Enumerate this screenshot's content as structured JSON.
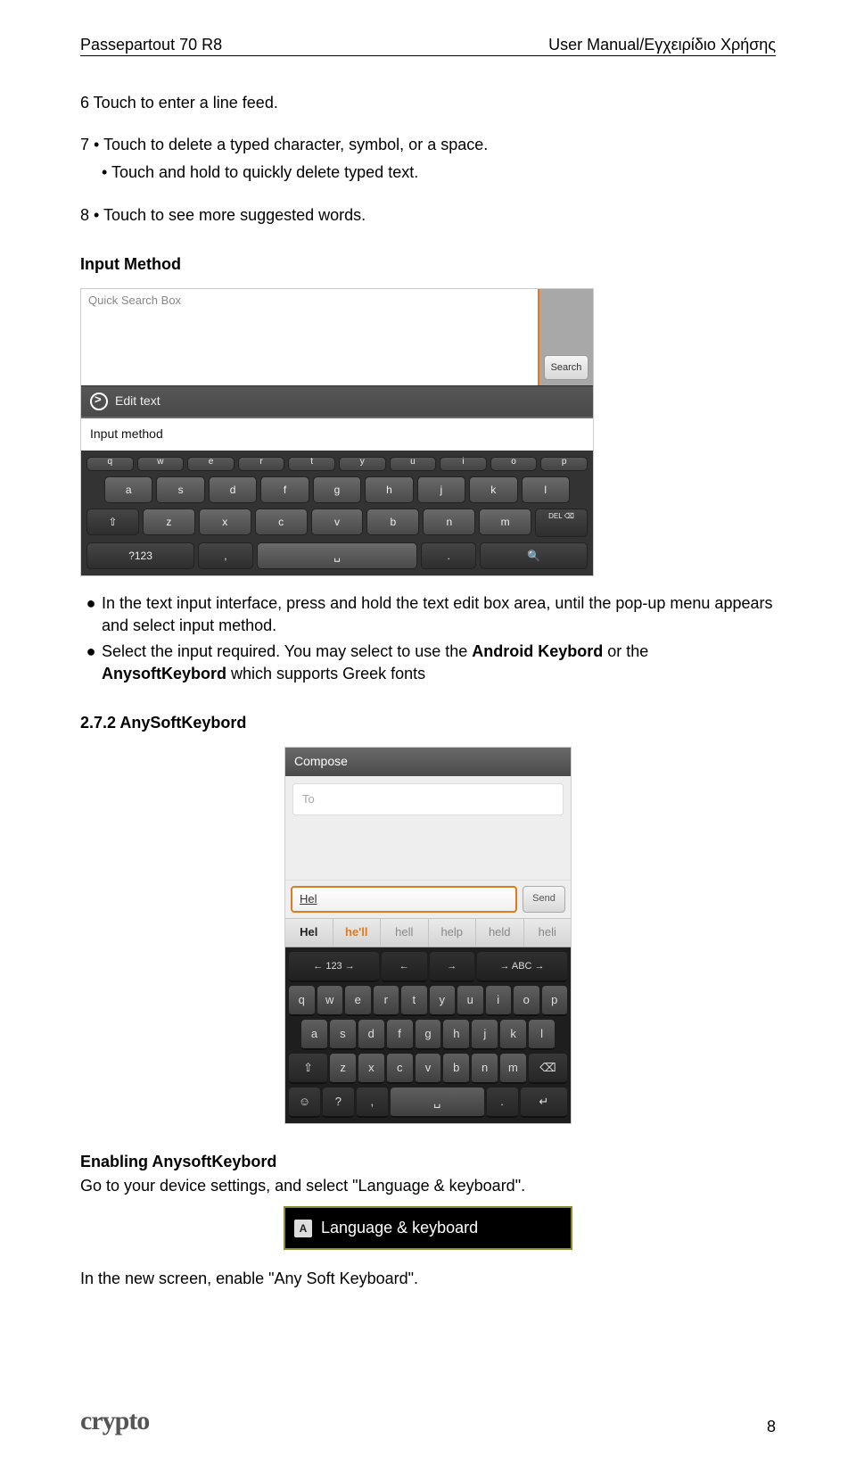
{
  "doc_header": {
    "left": "Passepartout 70 R8",
    "right": "User Manual/Εγχειρίδιο Χρήσης"
  },
  "body": {
    "p1": "6  Touch to enter a line feed.",
    "p2": "7 • Touch to delete a typed character, symbol, or a space.",
    "p2b": "• Touch and hold to quickly delete typed text.",
    "p3": "8 • Touch to see more suggested words.",
    "h_input": "Input Method",
    "bul1": "In the text input interface, press and hold the text edit box area, until the pop-up menu appears and select input method.",
    "bul2a": "Select the input required. You may select to use the ",
    "bul2b": "Android Keybord",
    "bul2c": " or the ",
    "bul2d": "AnysoftKeybord",
    "bul2e": " which supports Greek fonts",
    "h_272": "2.7.2 AnySoftKeybord",
    "h_enable": "Enabling AnysoftKeybord",
    "p_enable": "Go to your device settings, and select \"Language & keyboard\".",
    "p_last": "In the new screen, enable \"Any Soft Keyboard\"."
  },
  "screenshot1": {
    "qsb": "Quick Search Box",
    "search": "Search",
    "edit_text": "Edit text",
    "input_method": "Input method",
    "row0": [
      "q",
      "w",
      "e",
      "r",
      "t",
      "y",
      "u",
      "i",
      "o",
      "p"
    ],
    "row1": [
      "a",
      "s",
      "d",
      "f",
      "g",
      "h",
      "j",
      "k",
      "l"
    ],
    "row2_shift": "⇧",
    "row2": [
      "z",
      "x",
      "c",
      "v",
      "b",
      "n",
      "m"
    ],
    "row2_del": "DEL\n⌫",
    "row3": [
      "?123",
      ",",
      "␣",
      ".",
      "🔍"
    ]
  },
  "screenshot2": {
    "compose": "Compose",
    "to": "To",
    "typed": "Hel",
    "send": "Send",
    "suggestions": [
      "Hel",
      "he'll",
      "hell",
      "help",
      "held",
      "heli"
    ],
    "nav": [
      "← 123 →",
      "←",
      "→",
      "→ ABC →"
    ],
    "row1": [
      "q",
      "w",
      "e",
      "r",
      "t",
      "y",
      "u",
      "i",
      "o",
      "p"
    ],
    "row2": [
      "a",
      "s",
      "d",
      "f",
      "g",
      "h",
      "j",
      "k",
      "l"
    ],
    "row3_shift": "⇧",
    "row3": [
      "z",
      "x",
      "c",
      "v",
      "b",
      "n",
      "m"
    ],
    "row3_del": "⌫",
    "row4": [
      "☺",
      "?",
      ",",
      "␣",
      ".",
      "↵"
    ]
  },
  "screenshot3": {
    "icon": "A",
    "label": "Language & keyboard"
  },
  "footer": {
    "brand": "crypto",
    "pagenum": "8"
  }
}
